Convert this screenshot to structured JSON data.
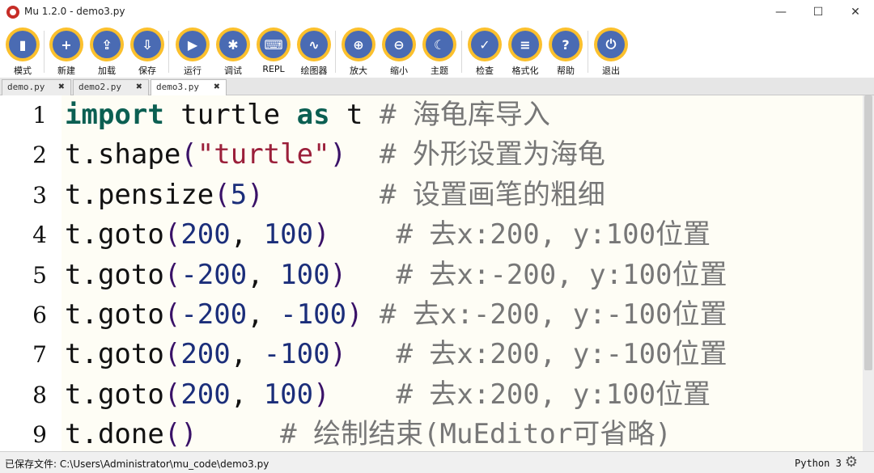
{
  "window": {
    "title": "Mu 1.2.0 - demo3.py",
    "minimize": "—",
    "maximize": "☐",
    "close": "✕"
  },
  "toolbar": {
    "buttons": [
      {
        "label": "模式",
        "icon": "mode-icon",
        "glyph": "▮"
      },
      {
        "label": "新建",
        "icon": "new-icon",
        "glyph": "+"
      },
      {
        "label": "加载",
        "icon": "load-icon",
        "glyph": "⇪"
      },
      {
        "label": "保存",
        "icon": "save-icon",
        "glyph": "⇩"
      },
      {
        "label": "运行",
        "icon": "run-icon",
        "glyph": "▶"
      },
      {
        "label": "调试",
        "icon": "debug-icon",
        "glyph": "✱"
      },
      {
        "label": "REPL",
        "icon": "keyboard-icon",
        "glyph": "⌨"
      },
      {
        "label": "绘图器",
        "icon": "plotter-icon",
        "glyph": "∿"
      },
      {
        "label": "放大",
        "icon": "zoom-in-icon",
        "glyph": "⊕"
      },
      {
        "label": "缩小",
        "icon": "zoom-out-icon",
        "glyph": "⊖"
      },
      {
        "label": "主题",
        "icon": "moon-icon",
        "glyph": "☾"
      },
      {
        "label": "检查",
        "icon": "thumbs-up-icon",
        "glyph": "✓"
      },
      {
        "label": "格式化",
        "icon": "format-icon",
        "glyph": "≡"
      },
      {
        "label": "帮助",
        "icon": "help-icon",
        "glyph": "?"
      },
      {
        "label": "退出",
        "icon": "power-icon",
        "glyph": "⏻"
      }
    ]
  },
  "tabs": [
    {
      "label": "demo.py",
      "close": "✖"
    },
    {
      "label": "demo2.py",
      "close": "✖"
    },
    {
      "label": "demo3.py",
      "close": "✖"
    }
  ],
  "editor": {
    "line_numbers": [
      "1",
      "2",
      "3",
      "4",
      "5",
      "6",
      "7",
      "8",
      "9"
    ],
    "lines": [
      [
        [
          "kw",
          "import"
        ],
        [
          "plain",
          " turtle "
        ],
        [
          "kw",
          "as"
        ],
        [
          "plain",
          " t "
        ],
        [
          "comment",
          "# 海龟库导入"
        ]
      ],
      [
        [
          "plain",
          "t.shape"
        ],
        [
          "paren",
          "("
        ],
        [
          "str",
          "\"turtle\""
        ],
        [
          "paren",
          ")"
        ],
        [
          "plain",
          "  "
        ],
        [
          "comment",
          "# 外形设置为海龟"
        ]
      ],
      [
        [
          "plain",
          "t.pensize"
        ],
        [
          "paren",
          "("
        ],
        [
          "num",
          "5"
        ],
        [
          "paren",
          ")"
        ],
        [
          "plain",
          "       "
        ],
        [
          "comment",
          "# 设置画笔的粗细"
        ]
      ],
      [
        [
          "plain",
          "t.goto"
        ],
        [
          "paren",
          "("
        ],
        [
          "num",
          "200"
        ],
        [
          "plain",
          ", "
        ],
        [
          "num",
          "100"
        ],
        [
          "paren",
          ")"
        ],
        [
          "plain",
          "    "
        ],
        [
          "comment",
          "# 去x:200, y:100位置"
        ]
      ],
      [
        [
          "plain",
          "t.goto"
        ],
        [
          "paren",
          "("
        ],
        [
          "num",
          "-200"
        ],
        [
          "plain",
          ", "
        ],
        [
          "num",
          "100"
        ],
        [
          "paren",
          ")"
        ],
        [
          "plain",
          "   "
        ],
        [
          "comment",
          "# 去x:-200, y:100位置"
        ]
      ],
      [
        [
          "plain",
          "t.goto"
        ],
        [
          "paren",
          "("
        ],
        [
          "num",
          "-200"
        ],
        [
          "plain",
          ", "
        ],
        [
          "num",
          "-100"
        ],
        [
          "paren",
          ")"
        ],
        [
          "plain",
          " "
        ],
        [
          "comment",
          "# 去x:-200, y:-100位置"
        ]
      ],
      [
        [
          "plain",
          "t.goto"
        ],
        [
          "paren",
          "("
        ],
        [
          "num",
          "200"
        ],
        [
          "plain",
          ", "
        ],
        [
          "num",
          "-100"
        ],
        [
          "paren",
          ")"
        ],
        [
          "plain",
          "   "
        ],
        [
          "comment",
          "# 去x:200, y:-100位置"
        ]
      ],
      [
        [
          "plain",
          "t.goto"
        ],
        [
          "paren",
          "("
        ],
        [
          "num",
          "200"
        ],
        [
          "plain",
          ", "
        ],
        [
          "num",
          "100"
        ],
        [
          "paren",
          ")"
        ],
        [
          "plain",
          "    "
        ],
        [
          "comment",
          "# 去x:200, y:100位置"
        ]
      ],
      [
        [
          "plain",
          "t.done"
        ],
        [
          "paren",
          "()"
        ],
        [
          "plain",
          "     "
        ],
        [
          "comment",
          "# 绘制结束(MuEditor可省略)"
        ]
      ]
    ]
  },
  "status": {
    "message": "已保存文件: C:\\Users\\Administrator\\mu_code\\demo3.py",
    "mode": "Python 3",
    "settings_glyph": "⚙"
  },
  "colors": {
    "button_ring": "#fbc02d",
    "button_fill": "#4a6bb3",
    "keyword": "#0b5f52",
    "string": "#9b1f3a",
    "number": "#1b2e7a",
    "comment": "#777777",
    "editor_bg": "#fefdf5"
  }
}
